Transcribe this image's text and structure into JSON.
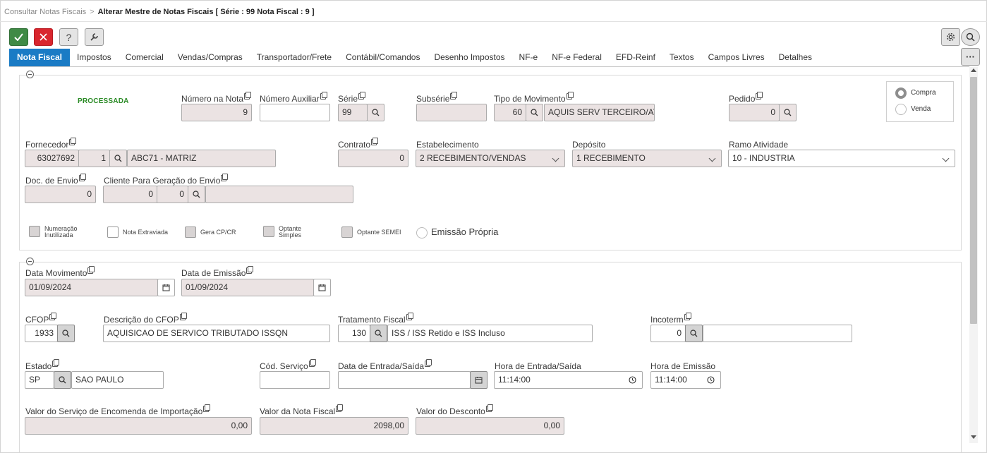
{
  "breadcrumb": {
    "parent": "Consultar Notas Fiscais",
    "separator": ">",
    "current": "Alterar Mestre de Notas Fiscais [ Série : 99 Nota Fiscal : 9 ]"
  },
  "toolbar": {
    "confirm_icon": "check-icon",
    "cancel_icon": "close-icon",
    "help_label": "?",
    "tools_icon": "wrench-icon",
    "settings_icon": "gear-icon",
    "search_icon": "search-icon",
    "more_label": "···"
  },
  "tabs": [
    {
      "label": "Nota Fiscal",
      "active": true
    },
    {
      "label": "Impostos"
    },
    {
      "label": "Comercial"
    },
    {
      "label": "Vendas/Compras"
    },
    {
      "label": "Transportador/Frete"
    },
    {
      "label": "Contábil/Comandos"
    },
    {
      "label": "Desenho Impostos"
    },
    {
      "label": "NF-e"
    },
    {
      "label": "NF-e Federal"
    },
    {
      "label": "EFD-Reinf"
    },
    {
      "label": "Textos"
    },
    {
      "label": "Campos Livres"
    },
    {
      "label": "Detalhes"
    }
  ],
  "header": {
    "status": "PROCESSADA",
    "numero_nota": {
      "label": "Número na Nota",
      "value": "9"
    },
    "numero_auxiliar": {
      "label": "Número Auxiliar",
      "value": ""
    },
    "serie": {
      "label": "Série",
      "value": "99"
    },
    "subserie": {
      "label": "Subsérie",
      "value": ""
    },
    "tipo_movimento": {
      "label": "Tipo de Movimento",
      "code": "60",
      "description": "AQUIS SERV TERCEIRO/ATIVO"
    },
    "pedido": {
      "label": "Pedido",
      "value": "0"
    },
    "tipo": {
      "options": [
        "Compra",
        "Venda"
      ],
      "selected": "Compra"
    },
    "fornecedor": {
      "label": "Fornecedor",
      "code": "63027692",
      "filial": "1",
      "description": "ABC71 - MATRIZ"
    },
    "contrato": {
      "label": "Contrato",
      "value": "0"
    },
    "estabelecimento": {
      "label": "Estabelecimento",
      "value": "2 RECEBIMENTO/VENDAS"
    },
    "deposito": {
      "label": "Depósito",
      "value": "1 RECEBIMENTO"
    },
    "ramo_atividade": {
      "label": "Ramo Atividade",
      "value": "10 - INDUSTRIA"
    },
    "doc_envio": {
      "label": "Doc. de Envio",
      "value": "0"
    },
    "cliente_envio": {
      "label": "Cliente Para Geração do Envio",
      "code": "0",
      "filial": "0",
      "description": ""
    },
    "checks": {
      "numeracao_l1": "Numeração",
      "numeracao_l2": "Inutilizada",
      "nota_extraviada": "Nota Extraviada",
      "gera_cp_cr": "Gera CP/CR",
      "optante_l1": "Optante",
      "optante_l2": "Simples",
      "optante_semei": "Optante SEMEI",
      "emissao_propria": "Emissão Própria"
    }
  },
  "details": {
    "data_movimento": {
      "label": "Data Movimento",
      "value": "01/09/2024"
    },
    "data_emissao": {
      "label": "Data de Emissão",
      "value": "01/09/2024"
    },
    "cfop": {
      "label": "CFOP",
      "value": "1933"
    },
    "descricao_cfop": {
      "label": "Descrição do CFOP",
      "value": "AQUISICAO DE SERVICO TRIBUTADO ISSQN"
    },
    "tratamento_fiscal": {
      "label": "Tratamento Fiscal",
      "code": "130",
      "description": "ISS / ISS Retido e ISS Incluso"
    },
    "incoterm": {
      "label": "Incoterm",
      "value": "0",
      "description": ""
    },
    "estado": {
      "label": "Estado",
      "code": "SP",
      "description": "SAO PAULO"
    },
    "cod_servico": {
      "label": "Cód. Serviço",
      "value": ""
    },
    "data_entrada_saida": {
      "label": "Data de Entrada/Saída",
      "value": ""
    },
    "hora_entrada_saida": {
      "label": "Hora de Entrada/Saída",
      "value": "11:14:00"
    },
    "hora_emissao": {
      "label": "Hora de Emissão",
      "value": "11:14:00"
    },
    "valor_servico_importacao": {
      "label": "Valor do Serviço de Encomenda de Importação",
      "value": "0,00"
    },
    "valor_nota_fiscal": {
      "label": "Valor da Nota Fiscal",
      "value": "2098,00"
    },
    "valor_desconto": {
      "label": "Valor do Desconto",
      "value": "0,00"
    }
  },
  "colors": {
    "accent": "#1a7bc5",
    "confirm": "#3f8a45",
    "cancel": "#d9262e",
    "status": "#2a8a25",
    "readonly_field": "#ebe3e3"
  }
}
